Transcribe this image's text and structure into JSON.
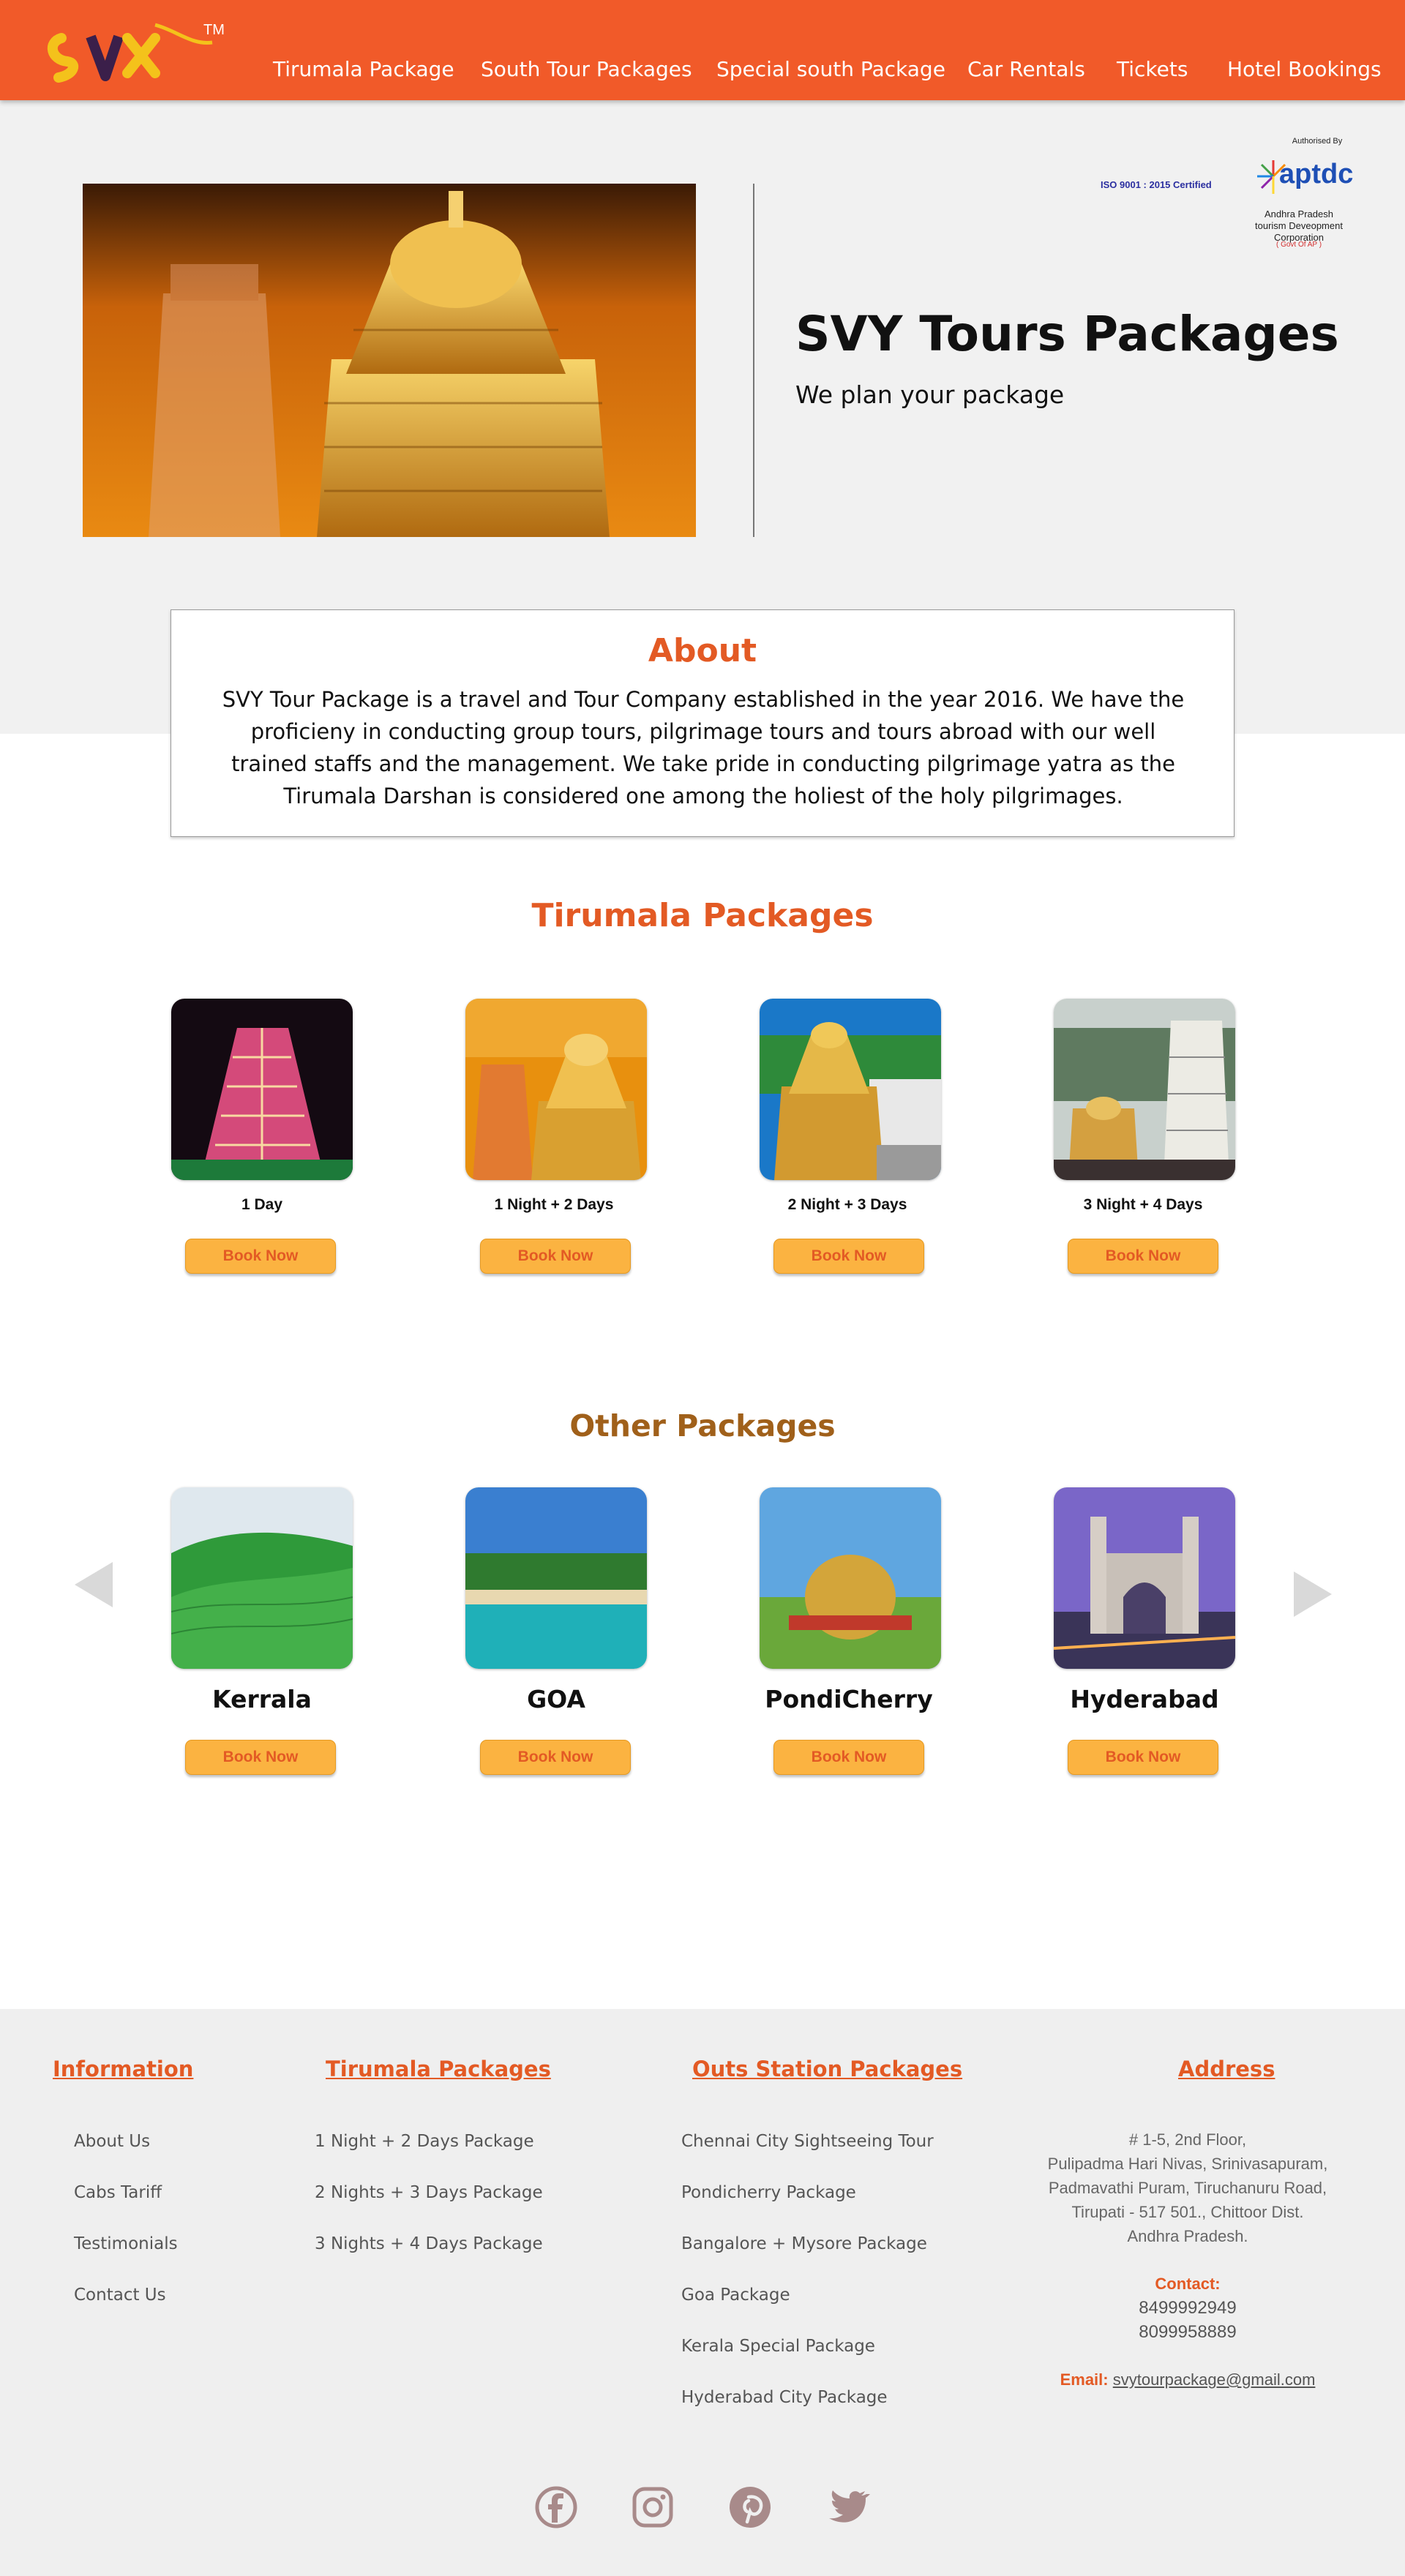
{
  "header": {
    "logo_text": "SVY",
    "logo_tm": "TM",
    "nav": [
      "Tirumala Package",
      "South Tour Packages",
      "Special south Package",
      "Car Rentals",
      "Tickets",
      "Hotel Bookings"
    ]
  },
  "hero": {
    "title": "SVY Tours Packages",
    "subtitle": "We plan your package"
  },
  "certification": {
    "authorised_by": "Authorised By",
    "iso": "ISO 9001 : 2015 Certified",
    "logo_text": "aptdc",
    "org_line1": "Andhra Pradesh",
    "org_line2": "tourism Deveopment Corporation",
    "govt": "( Govt Of AP )"
  },
  "about": {
    "title": "About",
    "text": "SVY Tour Package is a travel and Tour Company established in the year 2016. We have the proficieny in conducting group tours, pilgrimage tours and tours abroad with our well trained staffs and the management. We take pride in conducting pilgrimage yatra as the Tirumala Darshan is considered one among the holiest of the holy pilgrimages."
  },
  "tirumala": {
    "title": "Tirumala Packages",
    "items": [
      {
        "label": "1 Day",
        "button": "Book Now"
      },
      {
        "label": "1 Night + 2 Days",
        "button": "Book Now"
      },
      {
        "label": "2 Night + 3 Days",
        "button": "Book Now"
      },
      {
        "label": "3 Night + 4 Days",
        "button": "Book Now"
      }
    ]
  },
  "other": {
    "title": "Other Packages",
    "items": [
      {
        "label": "Kerrala",
        "button": "Book Now"
      },
      {
        "label": "GOA",
        "button": "Book Now"
      },
      {
        "label": "PondiCherry",
        "button": "Book Now"
      },
      {
        "label": "Hyderabad",
        "button": "Book Now"
      }
    ]
  },
  "footer": {
    "information": {
      "title": "Information",
      "links": [
        "About Us",
        "Cabs Tariff",
        "Testimonials",
        "Contact Us"
      ]
    },
    "tirumala": {
      "title": "Tirumala Packages",
      "links": [
        "1 Night + 2 Days Package",
        "2 Nights + 3 Days Package",
        "3 Nights + 4 Days Package"
      ]
    },
    "outstation": {
      "title": "Outs Station Packages",
      "links": [
        "Chennai City Sightseeing Tour",
        "Pondicherry Package",
        "Bangalore + Mysore Package",
        "Goa Package",
        "Kerala Special Package",
        "Hyderabad City Package"
      ]
    },
    "address": {
      "title": "Address",
      "lines": [
        "# 1-5, 2nd Floor,",
        "Pulipadma Hari Nivas, Srinivasapuram,",
        "Padmavathi Puram, Tiruchanuru Road,",
        "Tirupati - 517 501., Chittoor Dist.",
        "Andhra Pradesh."
      ],
      "contact_label": "Contact:",
      "phones": [
        "8499992949",
        "8099958889"
      ],
      "email_label": "Email:",
      "email": "svytourpackage@gmail.com"
    },
    "social": [
      "facebook-icon",
      "instagram-icon",
      "pinterest-icon",
      "twitter-icon"
    ]
  },
  "colors": {
    "brand_orange": "#f15a29",
    "heading_orange": "#e35a24",
    "other_heading": "#a0601a",
    "button_yellow": "#fbb341",
    "social_icon": "#a88a8a"
  }
}
